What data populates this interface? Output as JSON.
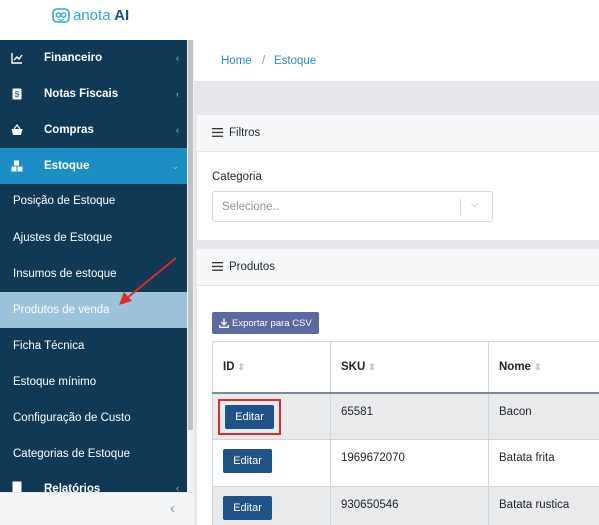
{
  "app": {
    "logo_text_a": "anota",
    "logo_text_b": " AI"
  },
  "colors": {
    "sidebar_bg": "#0f3954",
    "active_item": "#1b8ec6",
    "highlight_item": "#9dc3db",
    "accent": "#2b89c7",
    "edit_button": "#1f5287",
    "annotation": "#e02a2a"
  },
  "sidebar": {
    "items": [
      {
        "label": "Financeiro",
        "icon": "chart-line-icon"
      },
      {
        "label": "Notas Fiscais",
        "icon": "invoice-icon"
      },
      {
        "label": "Compras",
        "icon": "basket-icon"
      },
      {
        "label": "Estoque",
        "icon": "boxes-icon"
      }
    ],
    "sub_items": [
      {
        "label": "Posição de Estoque"
      },
      {
        "label": "Ajustes de Estoque"
      },
      {
        "label": "Insumos de estoque"
      },
      {
        "label": "Produtos de venda"
      },
      {
        "label": "Ficha Técnica"
      },
      {
        "label": "Estoque mínimo"
      },
      {
        "label": "Configuração de Custo"
      },
      {
        "label": "Categorias de Estoque"
      }
    ],
    "partial_item": {
      "label": "Relatórios",
      "icon": "report-icon"
    },
    "collapse_glyph": "‹"
  },
  "breadcrumb": {
    "home": "Home",
    "separator": "/",
    "current": "Estoque"
  },
  "filters": {
    "title": "Filtros",
    "category_label": "Categoria",
    "category_placeholder": "Selecione.."
  },
  "products": {
    "title": "Produtos",
    "export_label": "Exportar para CSV",
    "columns": [
      "ID",
      "SKU",
      "Nome"
    ],
    "edit_label": "Editar",
    "rows": [
      {
        "sku": "65581",
        "name": "Bacon"
      },
      {
        "sku": "1969672070",
        "name": "Batata frita"
      },
      {
        "sku": "930650546",
        "name": "Batata rustica"
      }
    ]
  }
}
